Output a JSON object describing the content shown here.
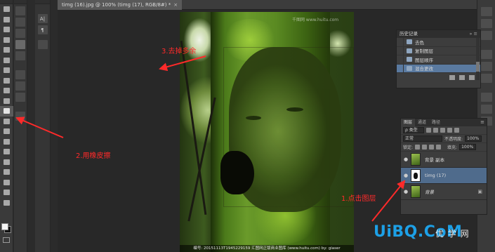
{
  "document": {
    "tab_title": "timg (16).jpg @ 100% (timg (17), RGB/8#) *",
    "close_glyph": "×"
  },
  "toolbar": {
    "tools": [
      "move-tool",
      "marquee-tool",
      "lasso-tool",
      "quick-select-tool",
      "crop-tool",
      "eyedropper-tool",
      "healing-brush-tool",
      "brush-tool",
      "clone-stamp-tool",
      "history-brush-tool",
      "eraser-tool",
      "gradient-tool",
      "blur-tool",
      "dodge-tool",
      "pen-tool",
      "type-tool",
      "path-select-tool",
      "shape-tool",
      "hand-tool",
      "zoom-tool"
    ],
    "active_tool": "eraser-tool"
  },
  "strip": {
    "type_glyph": "A|",
    "para_glyph": "¶"
  },
  "canvas": {
    "watermark_top": "千图网 www.huitu.com",
    "watermark_bottom": "编号: 20151113T1945229159   汇图网正版商业图库 (www.huitu.com)  by: giaser"
  },
  "annotations": {
    "step1": "1.点击图层",
    "step2": "2.用橡皮擦",
    "step3": "3.去掉多余"
  },
  "history_panel": {
    "title": "历史记录",
    "controls": "» ≡",
    "items": [
      {
        "label": "去色",
        "selected": false
      },
      {
        "label": "复制图层",
        "selected": false
      },
      {
        "label": "图层顺序",
        "selected": false
      },
      {
        "label": "混合更改",
        "selected": true
      }
    ]
  },
  "layers_panel": {
    "tabs": [
      "图层",
      "通道",
      "路径"
    ],
    "menu_glyph": "≡",
    "filter_label": "ρ 类型",
    "blend_mode": "正常",
    "opacity_label": "不透明度:",
    "opacity_value": "100%",
    "lock_label": "锁定:",
    "fill_label": "填充:",
    "fill_value": "100%",
    "layers": [
      {
        "name": "背景 副本",
        "visible": true,
        "selected": false,
        "type": "image"
      },
      {
        "name": "timg (17)",
        "visible": true,
        "selected": true,
        "type": "mask"
      },
      {
        "name": "背景",
        "visible": true,
        "selected": false,
        "type": "image",
        "locked": true
      }
    ]
  },
  "logo": {
    "brand": "UiBQ.CoM",
    "sub": "优 学 网"
  },
  "colors": {
    "annotation": "#ff2a2a",
    "selection": "#5a7aa0",
    "logo": "#1da0e6"
  }
}
